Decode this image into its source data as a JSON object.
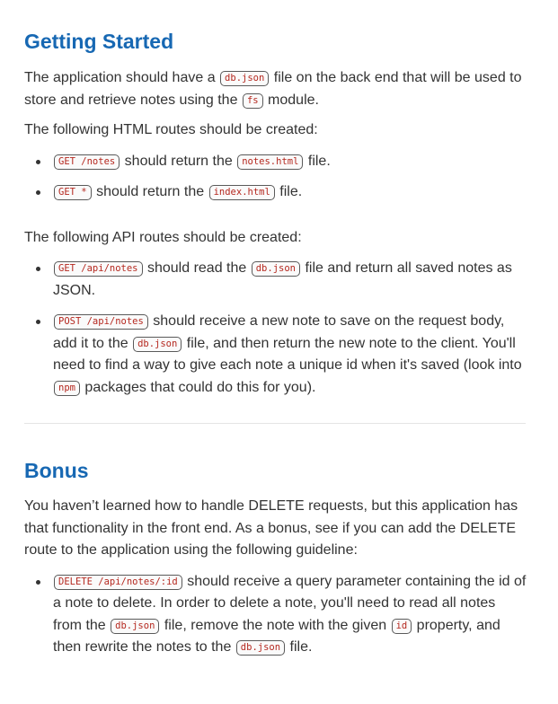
{
  "getting_started": {
    "heading": "Getting Started",
    "intro": {
      "t1": "The application should have a",
      "c1": "db.json",
      "t2": "file on the back end that will be used to store and retrieve notes using the",
      "c2": "fs",
      "t3": "module."
    },
    "html_routes_label": "The following HTML routes should be created:",
    "html_routes": [
      {
        "code": "GET /notes",
        "t1": "should return the",
        "code2": "notes.html",
        "t2": "file."
      },
      {
        "code": "GET *",
        "t1": "should return the",
        "code2": "index.html",
        "t2": "file."
      }
    ],
    "api_routes_label": "The following API routes should be created:",
    "api_get": {
      "code": "GET /api/notes",
      "t1": "should read the",
      "code2": "db.json",
      "t2": "file and return all saved notes as JSON."
    },
    "api_post": {
      "code": "POST /api/notes",
      "t1": "should receive a new note to save on the request body, add it to the",
      "code2": "db.json",
      "t2": "file, and then return the new note to the client. You'll need to find a way to give each note a unique id when it's saved (look into",
      "code3": "npm",
      "t3": "packages that could do this for you)."
    }
  },
  "bonus": {
    "heading": "Bonus",
    "intro": "You haven’t learned how to handle DELETE requests, but this application has that functionality in the front end. As a bonus, see if you can add the DELETE route to the application using the following guideline:",
    "delete_route": {
      "code": "DELETE /api/notes/:id",
      "t1": "should receive a query parameter containing the id of a note to delete. In order to delete a note, you'll need to read all notes from the",
      "code2": "db.json",
      "t2": "file, remove the note with the given",
      "code3": "id",
      "t3": "property, and then rewrite the notes to the",
      "code4": "db.json",
      "t4": "file."
    }
  }
}
